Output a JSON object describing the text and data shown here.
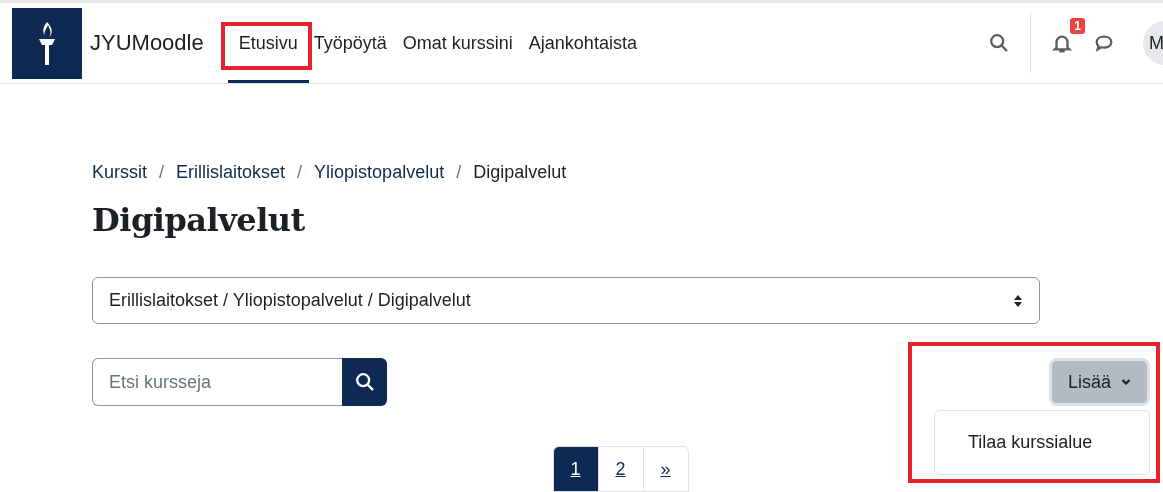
{
  "header": {
    "brand": "JYUMoodle",
    "nav": [
      {
        "label": "Etusivu",
        "selected": true,
        "highlighted": true
      },
      {
        "label": "Työpöytä",
        "selected": false,
        "highlighted": false
      },
      {
        "label": "Omat kurssini",
        "selected": false,
        "highlighted": false
      },
      {
        "label": "Ajankohtaista",
        "selected": false,
        "highlighted": false
      }
    ],
    "notification_count": "1",
    "avatar_initial": "M"
  },
  "breadcrumb": [
    {
      "label": "Kurssit",
      "kind": "link"
    },
    {
      "separator": "/",
      "label": "Erillislaitokset",
      "kind": "link"
    },
    {
      "separator": "/",
      "label": "Yliopistopalvelut",
      "kind": "link"
    },
    {
      "separator": "/",
      "label": "Digipalvelut",
      "kind": "current"
    }
  ],
  "title": "Digipalvelut",
  "category_select": {
    "value": "Erillislaitokset / Yliopistopalvelut / Digipalvelut"
  },
  "search": {
    "placeholder": "Etsi kursseja"
  },
  "more_menu": {
    "label": "Lisää",
    "expanded": true,
    "highlighted": true,
    "items": [
      "Tilaa kurssialue"
    ]
  },
  "pagination": [
    {
      "label": "1",
      "selected": true
    },
    {
      "label": "2",
      "selected": false
    },
    {
      "label": "»",
      "selected": false
    }
  ]
}
